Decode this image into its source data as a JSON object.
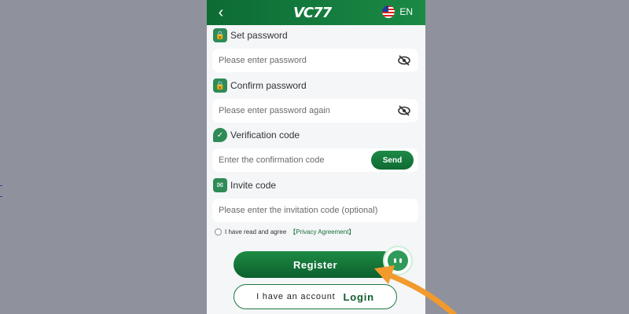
{
  "header": {
    "back_icon": "chevron-left-icon",
    "logo": "VC77",
    "language": "EN",
    "flag_icon": "us-flag-icon"
  },
  "form": {
    "set_password": {
      "label": "Set password",
      "placeholder": "Please enter password",
      "icon": "lock-icon",
      "eye_icon": "eye-off-icon"
    },
    "confirm_password": {
      "label": "Confirm password",
      "placeholder": "Please enter password again",
      "icon": "lock-icon",
      "eye_icon": "eye-off-icon"
    },
    "verification": {
      "label": "Verification code",
      "placeholder": "Enter the confirmation code",
      "icon": "shield-icon",
      "send_label": "Send"
    },
    "invite": {
      "label": "Invite code",
      "placeholder": "Please enter the invitation code (optional)",
      "icon": "envelope-icon"
    }
  },
  "agreement": {
    "text": "I have read and agree",
    "link": "【Privacy Agreement】"
  },
  "actions": {
    "register": "Register",
    "have_account": "I have an account",
    "login": "Login"
  },
  "colors": {
    "primary": "#1a8a45",
    "dark": "#0c5f2d",
    "arrow": "#f29a2e",
    "backdrop": "#8f929c"
  }
}
